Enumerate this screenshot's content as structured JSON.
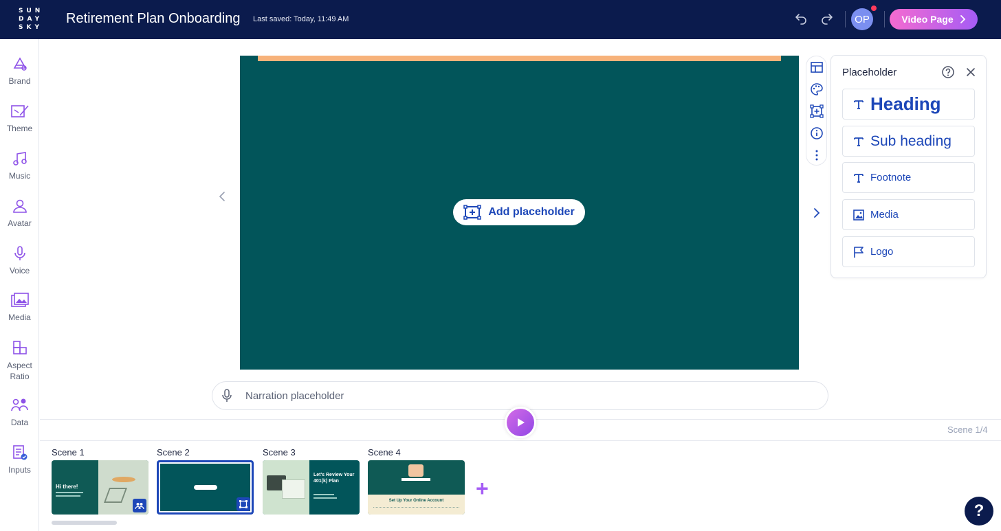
{
  "app": {
    "logo": "SUN DAY SKY",
    "title": "Retirement Plan Onboarding",
    "last_saved": "Last saved: Today, 11:49 AM",
    "user_initials": "OP",
    "primary_button": "Video Page",
    "accent_color": "#a55cf5",
    "brand_color": "#0b1b4d"
  },
  "sidebar": {
    "items": [
      {
        "label": "Brand",
        "icon": "brand-icon"
      },
      {
        "label": "Theme",
        "icon": "theme-icon"
      },
      {
        "label": "Music",
        "icon": "music-icon"
      },
      {
        "label": "Avatar",
        "icon": "avatar-icon"
      },
      {
        "label": "Voice",
        "icon": "voice-icon"
      },
      {
        "label": "Media",
        "icon": "media-icon"
      },
      {
        "label": "Aspect\nRatio",
        "icon": "aspect-ratio-icon"
      },
      {
        "label": "Data",
        "icon": "data-icon"
      },
      {
        "label": "Inputs",
        "icon": "inputs-icon"
      }
    ]
  },
  "stage": {
    "add_placeholder": "Add placeholder",
    "background_color": "#02555a"
  },
  "panel": {
    "title": "Placeholder",
    "items": [
      {
        "label": "Heading",
        "icon": "text-icon"
      },
      {
        "label": "Sub heading",
        "icon": "text-icon"
      },
      {
        "label": "Footnote",
        "icon": "text-icon"
      },
      {
        "label": "Media",
        "icon": "image-icon"
      },
      {
        "label": "Logo",
        "icon": "flag-icon"
      }
    ]
  },
  "narration": {
    "placeholder": "Narration placeholder"
  },
  "timeline": {
    "scene_counter": "Scene 1/4",
    "scenes": [
      {
        "label": "Scene 1",
        "thumb_text": "Hi there!"
      },
      {
        "label": "Scene 2",
        "thumb_text": ""
      },
      {
        "label": "Scene 3",
        "thumb_text": "Let's Review Your 401(k) Plan"
      },
      {
        "label": "Scene 4",
        "thumb_text": "Set Up Your Online Account"
      }
    ]
  }
}
